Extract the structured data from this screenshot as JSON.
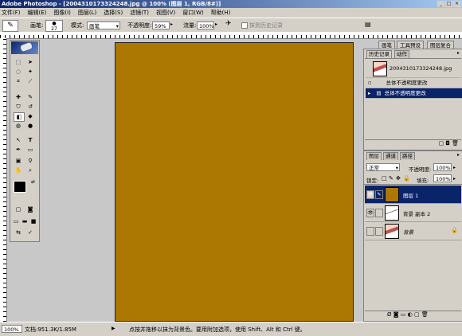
{
  "title": "Adobe Photoshop - [2004310173324248.jpg @ 100% (图层 1, RGB/8#)]",
  "window_controls": [
    "_",
    "□",
    "×"
  ],
  "menu": [
    "文件(F)",
    "编辑(E)",
    "图像(I)",
    "图层(L)",
    "选择(S)",
    "滤镜(T)",
    "视图(V)",
    "窗口(W)",
    "帮助(H)"
  ],
  "options": {
    "brush_label": "画笔:",
    "brush_size": "27",
    "mode_label": "模式:",
    "mode_value": "画笔",
    "opacity_label": "不透明度:",
    "opacity_value": "59%",
    "flow_label": "流量:",
    "flow_value": "100%",
    "erase_history": "抹到历史记录",
    "tabs": [
      "画笔",
      "工具预设",
      "图层复合"
    ]
  },
  "canvas_color": "#ad7802",
  "history_panel": {
    "tabs": [
      "历史记录",
      "动作"
    ],
    "snapshot": "2004310173324248.jpg",
    "items": [
      "总体不透明度更改",
      "总体不透明度更改"
    ],
    "selected_index": 1
  },
  "layers_panel": {
    "tabs": [
      "图层",
      "通道",
      "路径"
    ],
    "blend_mode": "正常",
    "opacity_label": "不透明度:",
    "opacity_value": "100%",
    "lock_label": "锁定:",
    "fill_label": "填充:",
    "fill_value": "100%",
    "layers": [
      {
        "name": "图层 1",
        "selected": true
      },
      {
        "name": "背景 副本 2",
        "selected": false
      },
      {
        "name": "背景",
        "selected": false
      }
    ]
  },
  "status": {
    "zoom": "100%",
    "doc": "文档:951.3K/1.85M",
    "hint": "点按并拖移以抹为背景色。要用附加选项，使用 Shift、Alt 和 Ctrl 键。"
  }
}
